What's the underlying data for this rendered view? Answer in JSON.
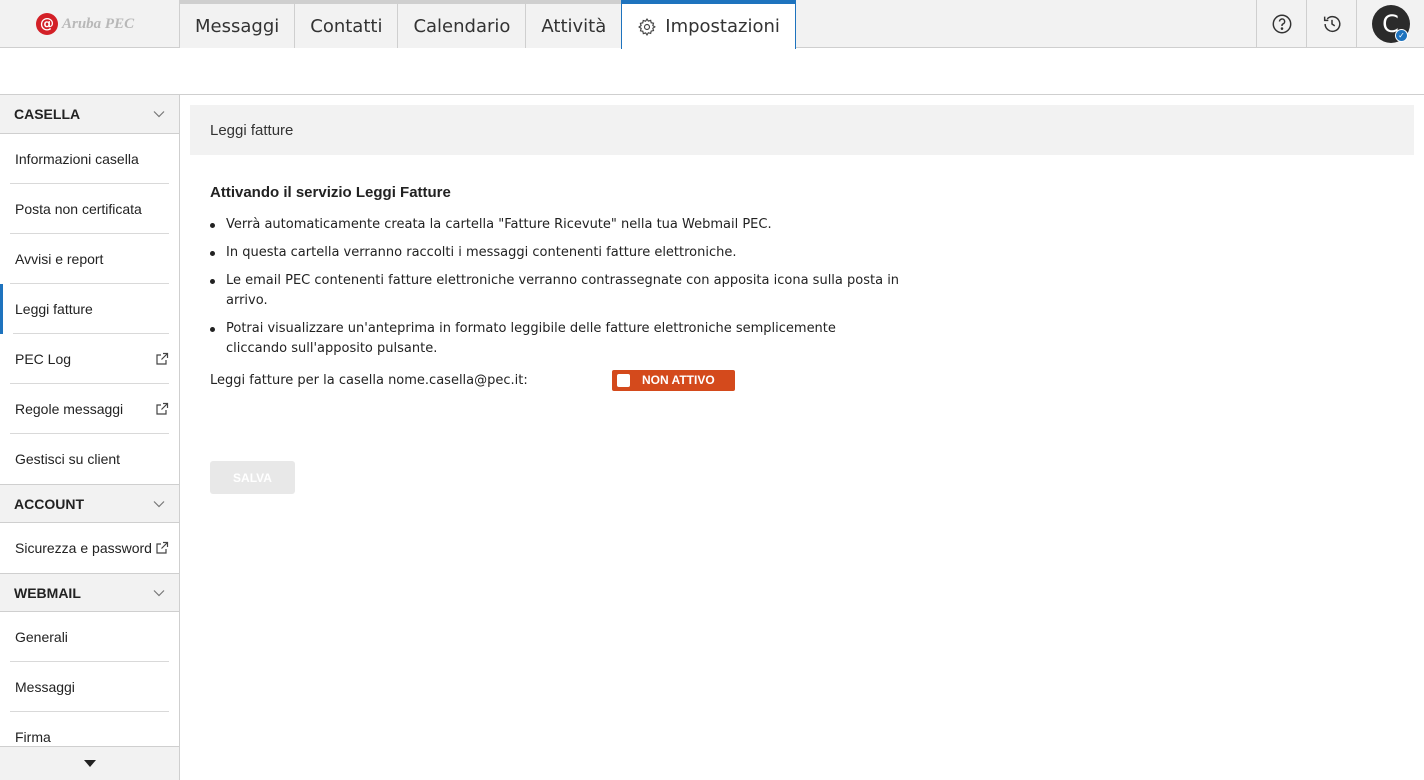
{
  "app": {
    "logo_text": "Aruba PEC",
    "logo_mark": "@"
  },
  "tabs": [
    {
      "label": "Messaggi"
    },
    {
      "label": "Contatti"
    },
    {
      "label": "Calendario"
    },
    {
      "label": "Attività"
    },
    {
      "label": "Impostazioni",
      "active": true,
      "icon": "gear-icon"
    }
  ],
  "top_icons": [
    "help-icon",
    "history-icon"
  ],
  "user": {
    "avatar_initial": "C"
  },
  "sidebar": {
    "casella": {
      "title": "CASELLA",
      "items": [
        {
          "label": "Informazioni casella"
        },
        {
          "label": "Posta non certificata"
        },
        {
          "label": "Avvisi e report"
        },
        {
          "label": "Leggi fatture",
          "active": true
        },
        {
          "label": "PEC Log",
          "external": true
        },
        {
          "label": "Regole messaggi",
          "external": true
        },
        {
          "label": "Gestisci su client"
        }
      ]
    },
    "account": {
      "title": "ACCOUNT",
      "items": [
        {
          "label": "Sicurezza e password",
          "external": true
        }
      ]
    },
    "webmail": {
      "title": "WEBMAIL",
      "items": [
        {
          "label": "Generali"
        },
        {
          "label": "Messaggi"
        },
        {
          "label": "Firma"
        }
      ]
    }
  },
  "panel": {
    "title": "Leggi fatture",
    "heading": "Attivando il servizio Leggi Fatture",
    "bullets": [
      "Verrà automaticamente creata la cartella \"Fatture Ricevute\" nella tua Webmail PEC.",
      "In questa cartella verranno raccolti i messaggi contenenti fatture elettroniche.",
      "Le email PEC contenenti fatture elettroniche verranno contrassegnate con apposita icona sulla posta in arrivo.",
      "Potrai visualizzare un'anteprima in formato leggibile delle fatture elettroniche semplicemente cliccando sull'apposito pulsante."
    ],
    "toggle_label": "Leggi fatture per la casella nome.casella@pec.it:",
    "toggle_state": "NON ATTIVO",
    "toggle_color": "#d44a1c",
    "save_label": "SALVA"
  },
  "colors": {
    "accent": "#1e73be",
    "brand_red": "#d32027"
  }
}
